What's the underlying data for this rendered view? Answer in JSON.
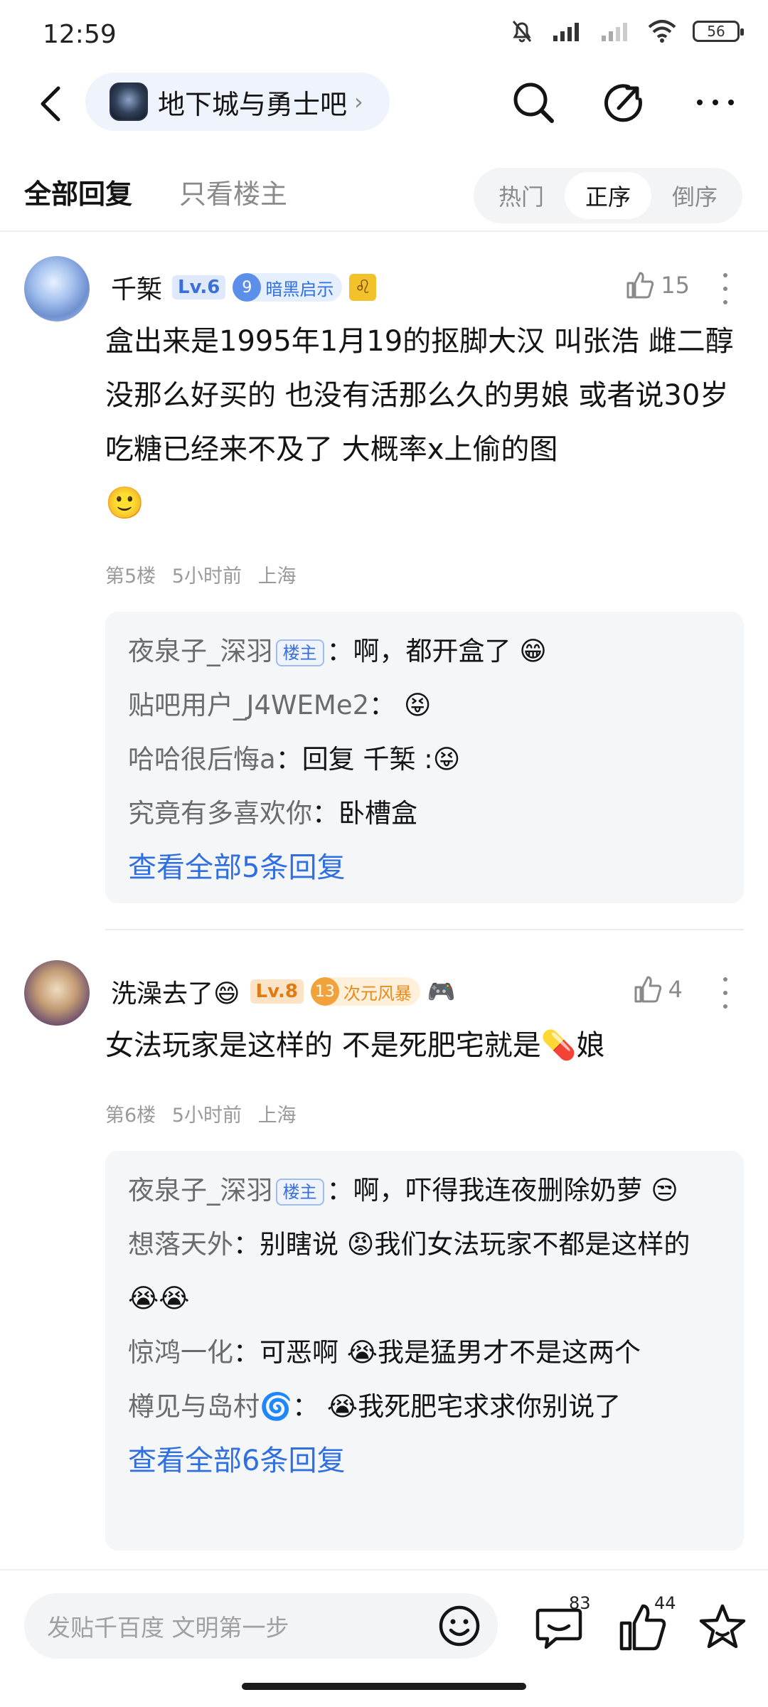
{
  "status_bar": {
    "time": "12:59",
    "battery": "56"
  },
  "nav": {
    "forum_name": "地下城与勇士吧",
    "chevron": "›"
  },
  "tabs": {
    "all_replies": "全部回复",
    "owner_only": "只看楼主",
    "sort": [
      "热门",
      "正序",
      "倒序"
    ],
    "sort_active": "正序"
  },
  "posts": [
    {
      "username": "千椠",
      "level": "Lv.6",
      "title_num": "9",
      "title": "暗黑启示",
      "zodiac": "♌",
      "likes": "15",
      "content": "盒出来是1995年1月19的抠脚大汉 叫张浩 雌二醇没那么好买的 也没有活那么久的男娘 或者说30岁吃糖已经来不及了 大概率x上偷的图",
      "content_emoji": "🙂",
      "floor": "第5楼",
      "time": "5小时前",
      "location": "上海",
      "replies": [
        {
          "name": "夜泉子_深羽",
          "owner": true,
          "sep": "：",
          "text": "啊，都开盒了",
          "emoji": "😁"
        },
        {
          "name": "贴吧用户_J4WEMe2",
          "owner": false,
          "sep": "：",
          "text": "",
          "emoji": "😝"
        },
        {
          "name": "哈哈很后悔a",
          "owner": false,
          "sep": "：",
          "text": "回复 千椠 :",
          "emoji": "😝"
        },
        {
          "name": "究竟有多喜欢你",
          "owner": false,
          "sep": "：",
          "text": "卧槽盒",
          "emoji": ""
        }
      ],
      "see_all": "查看全部5条回复"
    },
    {
      "username": "洗澡去了",
      "username_emoji": "😄",
      "level": "Lv.8",
      "title_num": "13",
      "title": "次元风暴",
      "extra_emoji": "🎮",
      "likes": "4",
      "content": "女法玩家是这样的 不是死肥宅就是💊娘",
      "floor": "第6楼",
      "time": "5小时前",
      "location": "上海",
      "replies": [
        {
          "name": "夜泉子_深羽",
          "owner": true,
          "sep": "：",
          "text": "啊，吓得我连夜删除奶萝",
          "emoji": "😒"
        },
        {
          "name": "想落天外",
          "owner": false,
          "sep": "：",
          "text": "别瞎说 😡我们女法玩家不都是这样的",
          "emoji": "😭😭"
        },
        {
          "name": "惊鸿一化",
          "owner": false,
          "sep": "：",
          "text": "可恶啊 😭我是猛男才不是这两个",
          "emoji": ""
        },
        {
          "name": "樽见与岛村🌀",
          "owner": false,
          "sep": "：",
          "text": "😭我死肥宅求求你别说了",
          "emoji": ""
        }
      ],
      "see_all": "查看全部6条回复"
    }
  ],
  "owner_tag": "楼主",
  "bottom_bar": {
    "input_placeholder": "发贴千百度 文明第一步",
    "comments_count": "83",
    "likes_count": "44"
  }
}
